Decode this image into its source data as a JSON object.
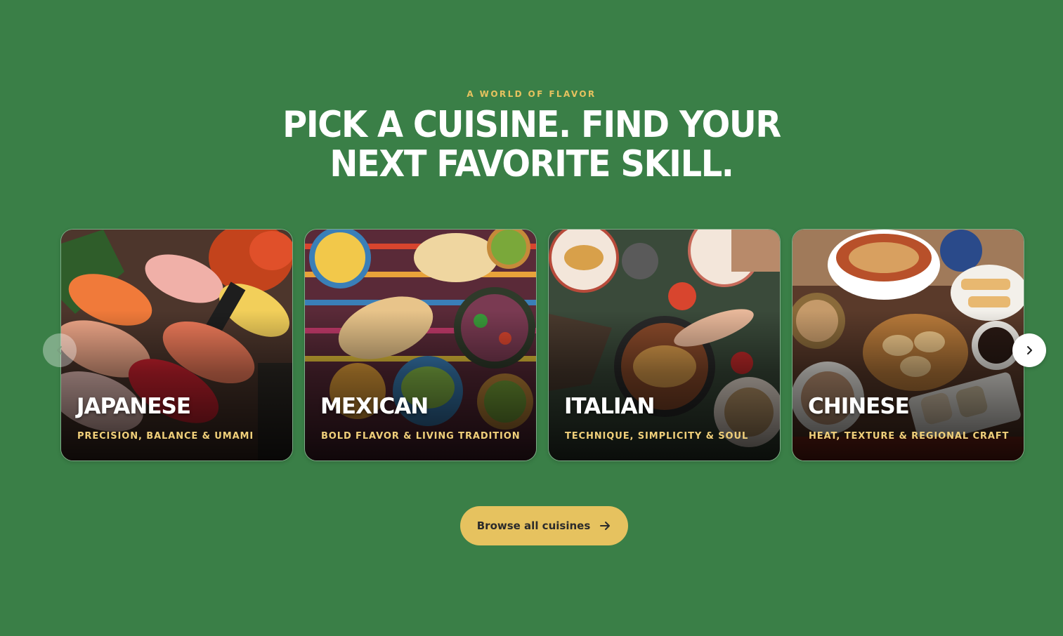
{
  "colors": {
    "background": "#3a7f47",
    "accent": "#e6c25f",
    "heading": "#ffffff",
    "tagline": "#f0cf7a"
  },
  "section": {
    "eyebrow": "A WORLD OF FLAVOR",
    "title_line1": "PICK A CUISINE. FIND YOUR",
    "title_line2": "NEXT FAVORITE SKILL."
  },
  "cards": [
    {
      "name": "JAPANESE",
      "tagline": "PRECISION, BALANCE & UMAMI"
    },
    {
      "name": "MEXICAN",
      "tagline": "BOLD FLAVOR & LIVING TRADITION"
    },
    {
      "name": "ITALIAN",
      "tagline": "TECHNIQUE, SIMPLICITY & SOUL"
    },
    {
      "name": "CHINESE",
      "tagline": "HEAT, TEXTURE & REGIONAL CRAFT"
    }
  ],
  "carousel": {
    "prev_icon": "chevron-left-icon",
    "next_icon": "chevron-right-icon"
  },
  "cta": {
    "label": "Browse all cuisines",
    "icon": "arrow-right-icon"
  }
}
